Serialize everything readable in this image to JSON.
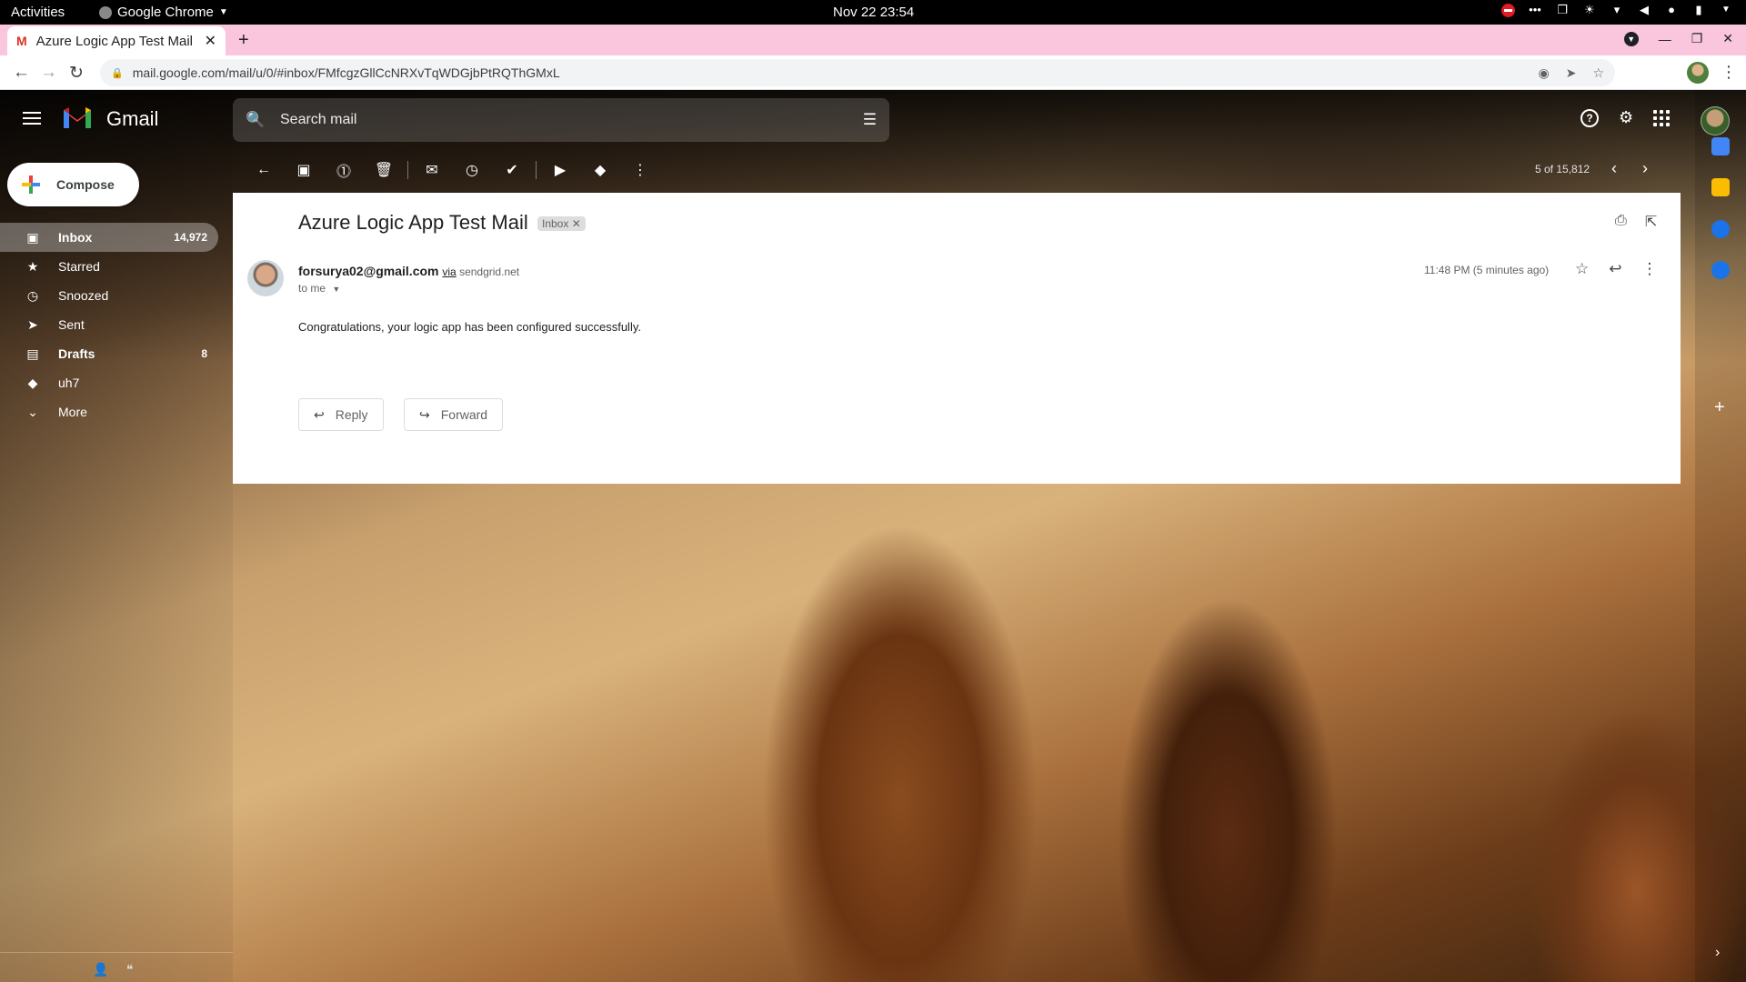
{
  "os_bar": {
    "activities": "Activities",
    "app_name": "Google Chrome",
    "clock": "Nov 22  23:54"
  },
  "browser": {
    "tab_title": "Azure Logic App Test Mail",
    "url": "mail.google.com/mail/u/0/#inbox/FMfcgzGllCcNRXvTqWDGjbPtRQThGMxL"
  },
  "gmail": {
    "brand": "Gmail",
    "search_placeholder": "Search mail",
    "compose_label": "Compose",
    "nav": [
      {
        "label": "Inbox",
        "count": "14,972",
        "icon": "inbox-icon"
      },
      {
        "label": "Starred",
        "count": "",
        "icon": "star-icon"
      },
      {
        "label": "Snoozed",
        "count": "",
        "icon": "clock-icon"
      },
      {
        "label": "Sent",
        "count": "",
        "icon": "send-icon"
      },
      {
        "label": "Drafts",
        "count": "8",
        "icon": "draft-icon"
      },
      {
        "label": "uh7",
        "count": "",
        "icon": "label-icon"
      },
      {
        "label": "More",
        "count": "",
        "icon": "chevron-down-icon"
      }
    ],
    "pager": "5 of 15,812"
  },
  "message": {
    "subject": "Azure Logic App Test Mail",
    "label_chip": "Inbox",
    "sender_email": "forsurya02@gmail.com",
    "via_word": "via",
    "via_domain": "sendgrid.net",
    "to": "to me",
    "time": "11:48 PM (5 minutes ago)",
    "body": "Congratulations, your logic app has been configured successfully.",
    "reply_label": "Reply",
    "forward_label": "Forward"
  },
  "colors": {
    "tab_strip": "#f9c6dd",
    "gmail_red": "#ea4335",
    "active_nav_bg": "rgba(255,255,255,0.32)"
  }
}
